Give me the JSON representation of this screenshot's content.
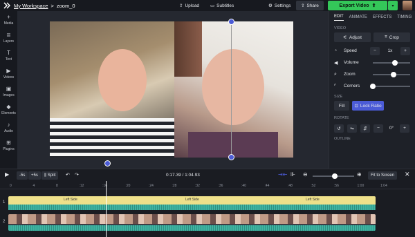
{
  "topbar": {
    "workspace": "My Workspace",
    "separator": ">",
    "project": "zoom_0",
    "upload": "Upload",
    "subtitles": "Subtitles",
    "settings": "Settings",
    "share": "Share",
    "export": "Export Video"
  },
  "sidebar": {
    "items": [
      "Media",
      "Layers",
      "Text",
      "Videos",
      "Images",
      "Elements",
      "Audio",
      "Plugins"
    ]
  },
  "panel": {
    "tabs": [
      "EDIT",
      "ANIMATE",
      "EFFECTS",
      "TIMING"
    ],
    "video_section": "VIDEO",
    "adjust": "Adjust",
    "crop": "Crop",
    "speed_label": "Speed",
    "speed_value": "1x",
    "volume_label": "Volume",
    "volume_level": 0.6,
    "zoom_label": "Zoom",
    "zoom_level": 0.55,
    "corners_label": "Corners",
    "corners_level": 0.0,
    "size_section": "SIZE",
    "fill": "Fill",
    "lock_ratio": "Lock Ratio",
    "rotate_section": "ROTATE",
    "rotate_value": "0°",
    "outline_section": "OUTLINE"
  },
  "timeline": {
    "skip_back": "-5s",
    "skip_fwd": "+5s",
    "split": "Split",
    "current_time": "0:17.39",
    "separator": "/",
    "total_time": "1:04.93",
    "fit": "Fit to Screen",
    "ruler_marks": [
      "0",
      "4",
      "8",
      ":12",
      ":16",
      ":20",
      ":24",
      ":28",
      ":32",
      ":36",
      ":40",
      ":44",
      ":48",
      ":52",
      ":56",
      "1:00",
      "1:04"
    ],
    "track1_number": "1",
    "track2_number": "2",
    "track1_labels": [
      "Left Side",
      "Left Side",
      "Left Side"
    ]
  }
}
